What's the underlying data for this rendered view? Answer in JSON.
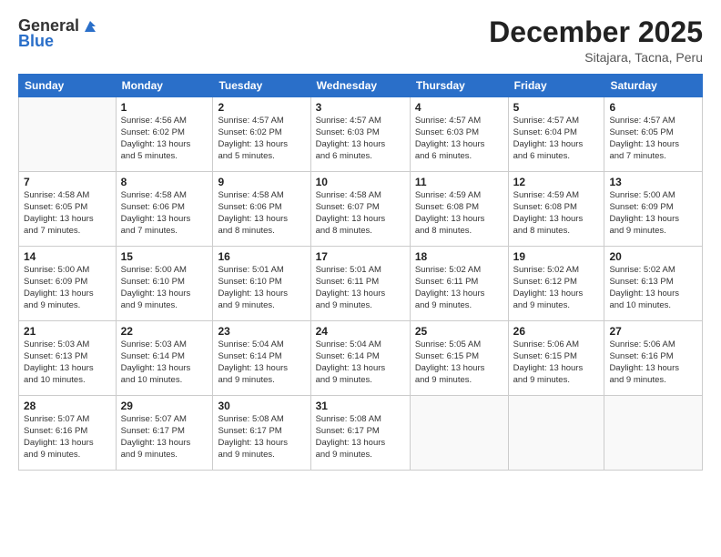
{
  "logo": {
    "line1": "General",
    "line2": "Blue"
  },
  "title": "December 2025",
  "subtitle": "Sitajara, Tacna, Peru",
  "headers": [
    "Sunday",
    "Monday",
    "Tuesday",
    "Wednesday",
    "Thursday",
    "Friday",
    "Saturday"
  ],
  "weeks": [
    [
      {
        "day": "",
        "info": ""
      },
      {
        "day": "1",
        "info": "Sunrise: 4:56 AM\nSunset: 6:02 PM\nDaylight: 13 hours\nand 5 minutes."
      },
      {
        "day": "2",
        "info": "Sunrise: 4:57 AM\nSunset: 6:02 PM\nDaylight: 13 hours\nand 5 minutes."
      },
      {
        "day": "3",
        "info": "Sunrise: 4:57 AM\nSunset: 6:03 PM\nDaylight: 13 hours\nand 6 minutes."
      },
      {
        "day": "4",
        "info": "Sunrise: 4:57 AM\nSunset: 6:03 PM\nDaylight: 13 hours\nand 6 minutes."
      },
      {
        "day": "5",
        "info": "Sunrise: 4:57 AM\nSunset: 6:04 PM\nDaylight: 13 hours\nand 6 minutes."
      },
      {
        "day": "6",
        "info": "Sunrise: 4:57 AM\nSunset: 6:05 PM\nDaylight: 13 hours\nand 7 minutes."
      }
    ],
    [
      {
        "day": "7",
        "info": "Sunrise: 4:58 AM\nSunset: 6:05 PM\nDaylight: 13 hours\nand 7 minutes."
      },
      {
        "day": "8",
        "info": "Sunrise: 4:58 AM\nSunset: 6:06 PM\nDaylight: 13 hours\nand 7 minutes."
      },
      {
        "day": "9",
        "info": "Sunrise: 4:58 AM\nSunset: 6:06 PM\nDaylight: 13 hours\nand 8 minutes."
      },
      {
        "day": "10",
        "info": "Sunrise: 4:58 AM\nSunset: 6:07 PM\nDaylight: 13 hours\nand 8 minutes."
      },
      {
        "day": "11",
        "info": "Sunrise: 4:59 AM\nSunset: 6:08 PM\nDaylight: 13 hours\nand 8 minutes."
      },
      {
        "day": "12",
        "info": "Sunrise: 4:59 AM\nSunset: 6:08 PM\nDaylight: 13 hours\nand 8 minutes."
      },
      {
        "day": "13",
        "info": "Sunrise: 5:00 AM\nSunset: 6:09 PM\nDaylight: 13 hours\nand 9 minutes."
      }
    ],
    [
      {
        "day": "14",
        "info": "Sunrise: 5:00 AM\nSunset: 6:09 PM\nDaylight: 13 hours\nand 9 minutes."
      },
      {
        "day": "15",
        "info": "Sunrise: 5:00 AM\nSunset: 6:10 PM\nDaylight: 13 hours\nand 9 minutes."
      },
      {
        "day": "16",
        "info": "Sunrise: 5:01 AM\nSunset: 6:10 PM\nDaylight: 13 hours\nand 9 minutes."
      },
      {
        "day": "17",
        "info": "Sunrise: 5:01 AM\nSunset: 6:11 PM\nDaylight: 13 hours\nand 9 minutes."
      },
      {
        "day": "18",
        "info": "Sunrise: 5:02 AM\nSunset: 6:11 PM\nDaylight: 13 hours\nand 9 minutes."
      },
      {
        "day": "19",
        "info": "Sunrise: 5:02 AM\nSunset: 6:12 PM\nDaylight: 13 hours\nand 9 minutes."
      },
      {
        "day": "20",
        "info": "Sunrise: 5:02 AM\nSunset: 6:13 PM\nDaylight: 13 hours\nand 10 minutes."
      }
    ],
    [
      {
        "day": "21",
        "info": "Sunrise: 5:03 AM\nSunset: 6:13 PM\nDaylight: 13 hours\nand 10 minutes."
      },
      {
        "day": "22",
        "info": "Sunrise: 5:03 AM\nSunset: 6:14 PM\nDaylight: 13 hours\nand 10 minutes."
      },
      {
        "day": "23",
        "info": "Sunrise: 5:04 AM\nSunset: 6:14 PM\nDaylight: 13 hours\nand 9 minutes."
      },
      {
        "day": "24",
        "info": "Sunrise: 5:04 AM\nSunset: 6:14 PM\nDaylight: 13 hours\nand 9 minutes."
      },
      {
        "day": "25",
        "info": "Sunrise: 5:05 AM\nSunset: 6:15 PM\nDaylight: 13 hours\nand 9 minutes."
      },
      {
        "day": "26",
        "info": "Sunrise: 5:06 AM\nSunset: 6:15 PM\nDaylight: 13 hours\nand 9 minutes."
      },
      {
        "day": "27",
        "info": "Sunrise: 5:06 AM\nSunset: 6:16 PM\nDaylight: 13 hours\nand 9 minutes."
      }
    ],
    [
      {
        "day": "28",
        "info": "Sunrise: 5:07 AM\nSunset: 6:16 PM\nDaylight: 13 hours\nand 9 minutes."
      },
      {
        "day": "29",
        "info": "Sunrise: 5:07 AM\nSunset: 6:17 PM\nDaylight: 13 hours\nand 9 minutes."
      },
      {
        "day": "30",
        "info": "Sunrise: 5:08 AM\nSunset: 6:17 PM\nDaylight: 13 hours\nand 9 minutes."
      },
      {
        "day": "31",
        "info": "Sunrise: 5:08 AM\nSunset: 6:17 PM\nDaylight: 13 hours\nand 9 minutes."
      },
      {
        "day": "",
        "info": ""
      },
      {
        "day": "",
        "info": ""
      },
      {
        "day": "",
        "info": ""
      }
    ]
  ]
}
